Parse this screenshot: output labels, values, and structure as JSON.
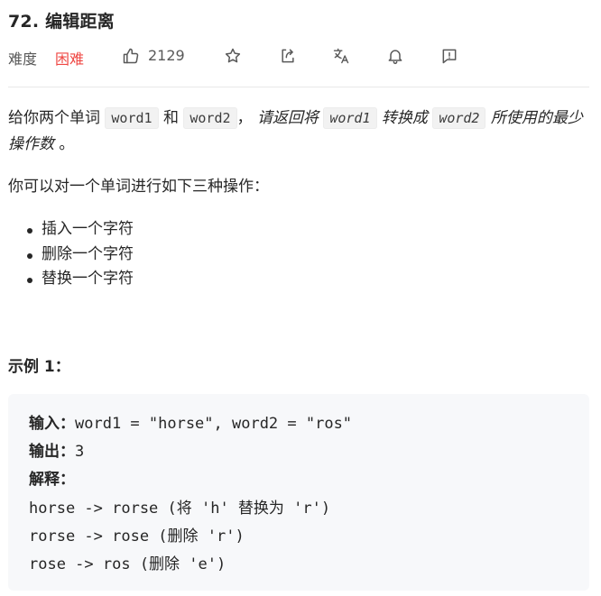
{
  "problem": {
    "title": "72. 编辑距离",
    "difficulty_label": "难度",
    "difficulty_value": "困难",
    "like_count": "2129"
  },
  "icons": {
    "like": "thumbs-up-icon",
    "star": "star-icon",
    "share": "share-icon",
    "translate": "translate-icon",
    "notify": "bell-icon",
    "feedback": "feedback-icon"
  },
  "description": {
    "p1_part1": "给你两个单词 ",
    "code1": "word1",
    "p1_part2": " 和 ",
    "code2": "word2",
    "p1_part3": "， ",
    "em1": "请返回将 ",
    "code3": "word1",
    "em2": " 转换成 ",
    "code4": "word2",
    "em3": " 所使用的最少操作数",
    "p1_end": " 。",
    "ops_intro": "你可以对一个单词进行如下三种操作：",
    "ops": [
      "插入一个字符",
      "删除一个字符",
      "替换一个字符"
    ]
  },
  "example": {
    "title": "示例 1：",
    "input_label": "输入：",
    "input_value": "word1 = \"horse\", word2 = \"ros\"",
    "output_label": "输出：",
    "output_value": "3",
    "explain_label": "解释：",
    "steps": [
      "horse -> rorse (将 'h' 替换为 'r')",
      "rorse -> rose (删除 'r')",
      "rose -> ros (删除 'e')"
    ]
  },
  "colors": {
    "hard": "#ef4743",
    "code_bg": "#f2f2f2",
    "example_bg": "#f7f8fa"
  }
}
